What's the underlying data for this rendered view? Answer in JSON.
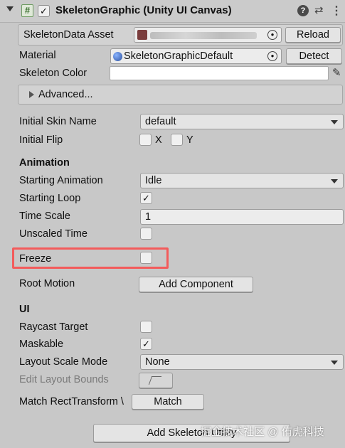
{
  "header": {
    "title": "SkeletonGraphic (Unity UI Canvas)",
    "enabled": true,
    "icons": [
      "hash-script-icon",
      "help-icon",
      "preset-sliders-icon",
      "kebab-menu-icon"
    ]
  },
  "skeleton_data_asset": {
    "label": "SkeletonData Asset",
    "value": "",
    "reload_label": "Reload"
  },
  "material": {
    "label": "Material",
    "value": "SkeletonGraphicDefault",
    "detect_label": "Detect"
  },
  "skeleton_color": {
    "label": "Skeleton Color",
    "color": "#ffffff"
  },
  "advanced": {
    "label": "Advanced..."
  },
  "initial_skin": {
    "label": "Initial Skin Name",
    "value": "default"
  },
  "initial_flip": {
    "label": "Initial Flip",
    "x_label": "X",
    "y_label": "Y",
    "x_checked": false,
    "y_checked": false
  },
  "animation_section": {
    "header": "Animation",
    "starting_animation": {
      "label": "Starting Animation",
      "value": "Idle"
    },
    "starting_loop": {
      "label": "Starting Loop",
      "checked": true,
      "check": "✓"
    },
    "time_scale": {
      "label": "Time Scale",
      "value": "1"
    },
    "unscaled_time": {
      "label": "Unscaled Time",
      "checked": false
    },
    "freeze": {
      "label": "Freeze",
      "checked": false,
      "highlight_color": "#f35b5b"
    },
    "root_motion": {
      "label": "Root Motion",
      "button_label": "Add Component"
    }
  },
  "ui_section": {
    "header": "UI",
    "raycast_target": {
      "label": "Raycast Target",
      "checked": false
    },
    "maskable": {
      "label": "Maskable",
      "checked": true,
      "check": "✓"
    },
    "layout_scale_mode": {
      "label": "Layout Scale Mode",
      "value": "None"
    },
    "edit_layout_bounds": {
      "label": "Edit Layout Bounds",
      "enabled": false
    },
    "match_rect": {
      "label": "Match RectTransform \\",
      "button_label": "Match"
    }
  },
  "footer": {
    "add_skeleton_button": "Add Skeleton Utility",
    "watermark": "掘金技术社区 @ 侑虎科技"
  },
  "colors": {
    "background": "#c8c8c8",
    "field": "#ececec",
    "button": "#e4e4e4",
    "highlight": "#f35b5b"
  }
}
